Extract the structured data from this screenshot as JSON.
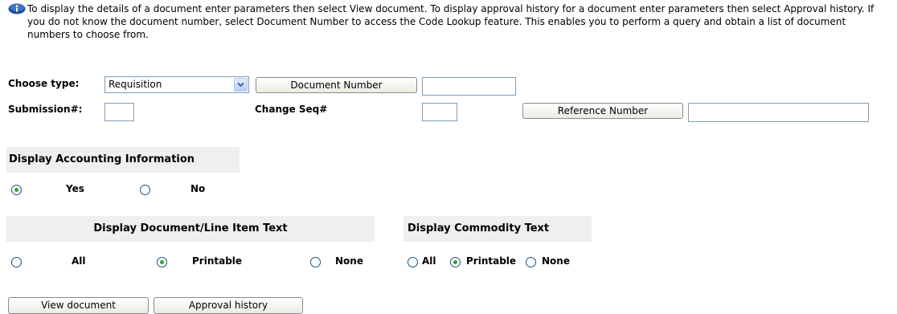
{
  "info": {
    "icon": "info-icon",
    "text": "To display the details of a document enter parameters then select View document. To display approval history for a document enter parameters then select Approval history. If you do not know the document number, select Document Number to access the Code Lookup feature. This enables you to perform a query and obtain a list of document numbers to choose from."
  },
  "form": {
    "choose_type_label": "Choose type:",
    "choose_type_value": "Requisition",
    "document_number_button": "Document Number",
    "document_number_value": "",
    "submission_label": "Submission#:",
    "submission_value": "",
    "change_seq_label": "Change Seq#",
    "change_seq_value": "",
    "reference_number_button": "Reference Number",
    "reference_number_value": ""
  },
  "accounting": {
    "header": "Display Accounting Information",
    "yes_label": "Yes",
    "no_label": "No",
    "selected": "Yes"
  },
  "line_item_text": {
    "header": "Display Document/Line Item Text",
    "all_label": "All",
    "printable_label": "Printable",
    "none_label": "None",
    "selected": "Printable"
  },
  "commodity_text": {
    "header": "Display Commodity Text",
    "all_label": "All",
    "printable_label": "Printable",
    "none_label": "None",
    "selected": "Printable"
  },
  "actions": {
    "view_document": "View document",
    "approval_history": "Approval history"
  },
  "colors": {
    "section_bg": "#efefef",
    "input_border": "#7f9db9",
    "info_icon_blue": "#1f4e99"
  }
}
